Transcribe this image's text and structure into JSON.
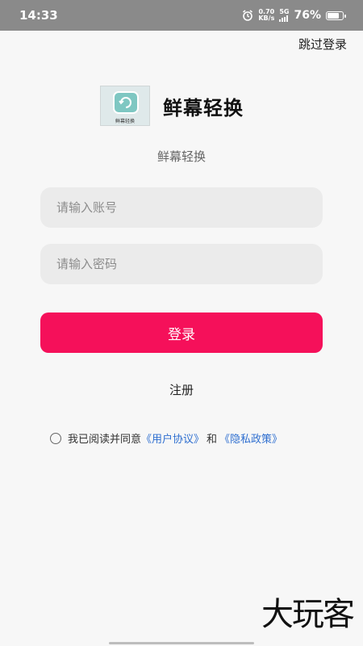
{
  "status_bar": {
    "time": "14:33",
    "icons": [
      "alarm-icon"
    ],
    "speed_value": "0.70",
    "speed_unit": "KB/s",
    "network": "5G",
    "battery_percent": "76%",
    "battery_level": 0.76,
    "color": "#8a8a8a"
  },
  "header": {
    "skip_label": "跳过登录"
  },
  "brand": {
    "logo_caption": "鲜幕轻换",
    "title": "鲜幕轻换",
    "subtitle": "鲜幕轻换"
  },
  "form": {
    "account_placeholder": "请输入账号",
    "password_placeholder": "请输入密码",
    "login_label": "登录",
    "register_label": "注册",
    "accent_color": "#f5105a"
  },
  "agreement": {
    "prefix": "我已阅读并同意",
    "user_agreement": "《用户协议》",
    "conjunction": "和",
    "privacy_policy": "《隐私政策》",
    "checked": false,
    "link_color": "#2f6fd0"
  },
  "watermark": {
    "text": "大玩客"
  }
}
